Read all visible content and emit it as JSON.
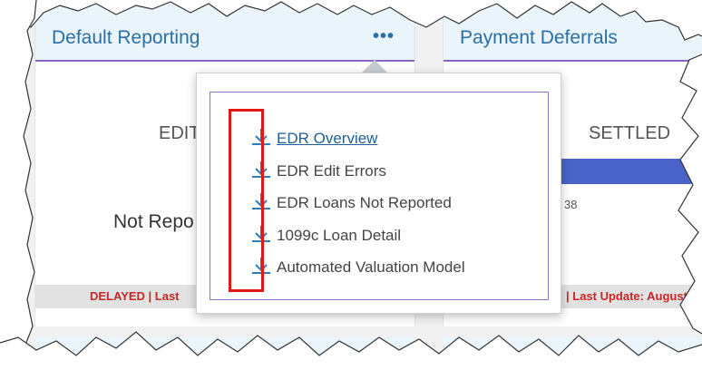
{
  "cards": {
    "default_reporting": {
      "title": "Default Reporting",
      "more_icon": "•••",
      "edit_label": "EDIT",
      "not_reported_label": "Not Repo",
      "status_text": "DELAYED | Last",
      "status_color": "#c62828"
    },
    "payment_deferrals": {
      "title": "Payment Deferrals",
      "settled_label": "SETTLED",
      "number_fragment": "38",
      "progress_color": "#4a63c8",
      "status_text": "| Last Update: August"
    }
  },
  "menu": {
    "items": [
      {
        "label": "EDR Overview",
        "icon": "download-icon"
      },
      {
        "label": "EDR Edit Errors",
        "icon": "download-icon"
      },
      {
        "label": "EDR Loans Not Reported",
        "icon": "download-icon"
      },
      {
        "label": "1099c Loan Detail",
        "icon": "download-icon"
      },
      {
        "label": "Automated Valuation Model",
        "icon": "download-icon"
      }
    ],
    "icon_color": "#2a7fc0",
    "highlight_color": "#e01818"
  }
}
